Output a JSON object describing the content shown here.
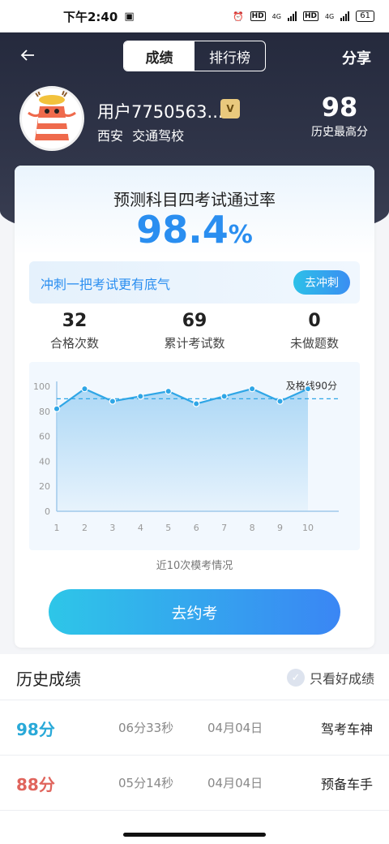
{
  "status_bar": {
    "time": "下午2:40",
    "battery": "61",
    "net1": "4G",
    "net2": "4G",
    "hd1": "HD",
    "hd2": "HD"
  },
  "nav": {
    "back_icon": "arrow-left-icon",
    "tabs": [
      {
        "label": "成绩",
        "active": true
      },
      {
        "label": "排行榜",
        "active": false
      }
    ],
    "share_label": "分享"
  },
  "profile": {
    "username": "用户7750563...",
    "vip_label": "V",
    "city": "西安",
    "school": "交通驾校",
    "best_score": "98",
    "best_score_label": "历史最高分"
  },
  "prediction": {
    "title": "预测科目四考试通过率",
    "rate": "98.4",
    "rate_unit": "%",
    "banner_text": "冲刺一把考试更有底气",
    "banner_button": "去冲刺"
  },
  "stats": [
    {
      "value": "32",
      "label": "合格次数"
    },
    {
      "value": "69",
      "label": "累计考试数"
    },
    {
      "value": "0",
      "label": "未做题数"
    }
  ],
  "chart_data": {
    "type": "area",
    "x": [
      1,
      2,
      3,
      4,
      5,
      6,
      7,
      8,
      9,
      10
    ],
    "values": [
      82,
      98,
      88,
      92,
      96,
      86,
      92,
      98,
      88,
      98
    ],
    "ylim": [
      0,
      100
    ],
    "yticks": [
      0,
      20,
      40,
      60,
      80,
      100
    ],
    "pass_line": 90,
    "pass_line_label": "及格线90分",
    "caption": "近10次模考情况",
    "colors": {
      "line": "#2fa6e6",
      "fill": "#a9d6f5",
      "pass_line": "#2fa6e6"
    }
  },
  "cta_label": "去约考",
  "history": {
    "title": "历史成绩",
    "filter_label": "只看好成绩",
    "rows": [
      {
        "score": "98分",
        "duration": "06分33秒",
        "date": "04月04日",
        "title": "驾考车神",
        "color": "#29a9d8"
      },
      {
        "score": "88分",
        "duration": "05分14秒",
        "date": "04月04日",
        "title": "预备车手",
        "color": "#e0645c"
      }
    ]
  }
}
